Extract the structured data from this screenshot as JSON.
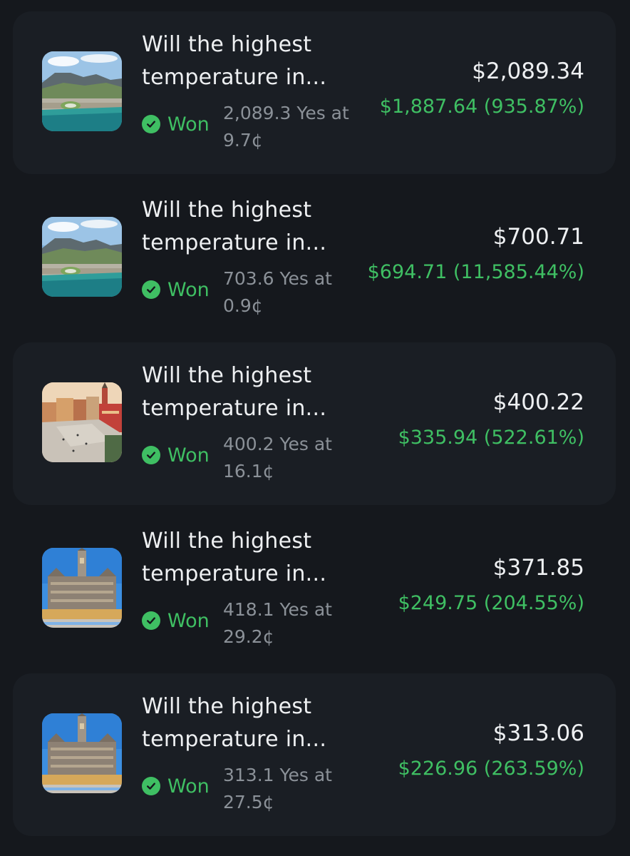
{
  "colors": {
    "background": "#15181d",
    "card_alt": "#1a1e24",
    "text_primary": "#eef0f2",
    "text_muted": "#8b9198",
    "positive": "#3fbf63"
  },
  "positions": [
    {
      "image_icon": "cape-town-aerial-photo",
      "title": "Will the highest temperature in...",
      "status_icon": "check-circle-icon",
      "status": "Won",
      "shares_line1": "2,089.3 Yes at",
      "shares_line2": "9.7¢",
      "value": "$2,089.34",
      "pnl": "$1,887.64 (935.87%)"
    },
    {
      "image_icon": "cape-town-aerial-photo",
      "title": "Will the highest temperature in...",
      "status_icon": "check-circle-icon",
      "status": "Won",
      "shares_line1": "703.6 Yes at",
      "shares_line2": "0.9¢",
      "value": "$700.71",
      "pnl": "$694.71 (11,585.44%)"
    },
    {
      "image_icon": "warsaw-old-town-photo",
      "title": "Will the highest temperature in...",
      "status_icon": "check-circle-icon",
      "status": "Won",
      "shares_line1": "400.2 Yes at",
      "shares_line2": "16.1¢",
      "value": "$400.22",
      "pnl": "$335.94 (522.61%)"
    },
    {
      "image_icon": "munich-town-hall-photo",
      "title": "Will the highest temperature in...",
      "status_icon": "check-circle-icon",
      "status": "Won",
      "shares_line1": "418.1 Yes at",
      "shares_line2": "29.2¢",
      "value": "$371.85",
      "pnl": "$249.75 (204.55%)"
    },
    {
      "image_icon": "munich-town-hall-photo",
      "title": "Will the highest temperature in...",
      "status_icon": "check-circle-icon",
      "status": "Won",
      "shares_line1": "313.1 Yes at",
      "shares_line2": "27.5¢",
      "value": "$313.06",
      "pnl": "$226.96 (263.59%)"
    }
  ]
}
